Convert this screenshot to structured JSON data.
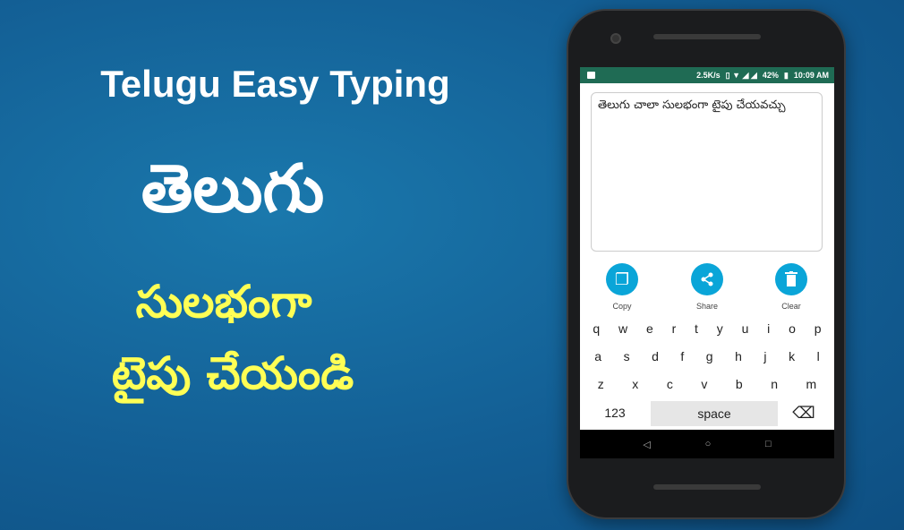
{
  "promo": {
    "title": "Telugu Easy Typing",
    "line1": "తెలుగు",
    "line2": "సులభంగా",
    "line3": "టైపు చేయండి",
    "line2_color": "#ffff55"
  },
  "status_bar": {
    "speed": "2.5K/s",
    "battery": "42%",
    "time": "10:09 AM",
    "color": "#1f6b54"
  },
  "editor": {
    "text": "తెలుగు చాలా సులభంగా టైపు చేయవచ్చు"
  },
  "actions": [
    {
      "label": "Copy",
      "icon": "copy-icon"
    },
    {
      "label": "Share",
      "icon": "share-icon"
    },
    {
      "label": "Clear",
      "icon": "trash-icon"
    }
  ],
  "accent": "#0aa5d8",
  "keyboard": {
    "row1": [
      "q",
      "w",
      "e",
      "r",
      "t",
      "y",
      "u",
      "i",
      "o",
      "p"
    ],
    "row2": [
      "a",
      "s",
      "d",
      "f",
      "g",
      "h",
      "j",
      "k",
      "l"
    ],
    "row3": [
      "z",
      "x",
      "c",
      "v",
      "b",
      "n",
      "m"
    ],
    "numbers": "123",
    "space": "space"
  }
}
